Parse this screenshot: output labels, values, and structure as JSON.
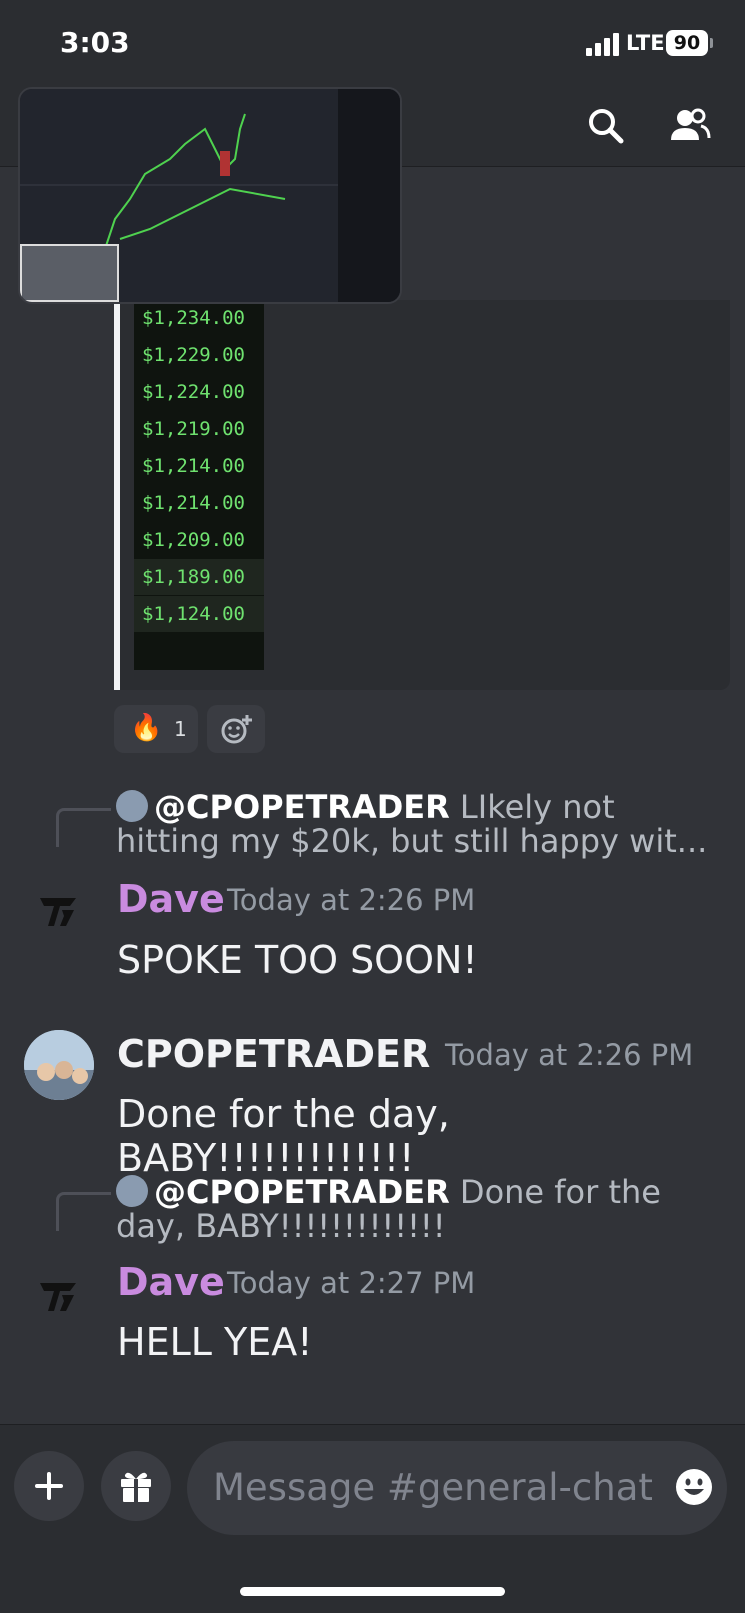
{
  "status_bar": {
    "time": "3:03",
    "network": "LTE",
    "battery": "90"
  },
  "header": {
    "search_icon": "search-icon",
    "members_icon": "members-icon"
  },
  "embed": {
    "prices": [
      "$1,234.00",
      "$1,229.00",
      "$1,224.00",
      "$1,219.00",
      "$1,214.00",
      "$1,214.00",
      "$1,209.00",
      "$1,189.00",
      "$1,124.00"
    ]
  },
  "reactions": [
    {
      "emoji": "🔥",
      "count": "1"
    }
  ],
  "messages": [
    {
      "reply_user": "@CPOPETRADER",
      "reply_text": "LIkely not hitting my $20k, but still happy wit...",
      "username": "Dave",
      "username_color": "#c98bdf",
      "timestamp": "Today at 2:26 PM",
      "content": "SPOKE TOO SOON!"
    },
    {
      "username": "CPOPETRADER",
      "username_color": "#f2f3f5",
      "timestamp": "Today at 2:26 PM",
      "content": "Done for the day, BABY!!!!!!!!!!!!!"
    },
    {
      "reply_user": "@CPOPETRADER",
      "reply_text": "Done for the day, BABY!!!!!!!!!!!!!",
      "username": "Dave",
      "username_color": "#c98bdf",
      "timestamp": "Today at 2:27 PM",
      "content": "HELL YEA!"
    }
  ],
  "composer": {
    "placeholder": "Message #general-chat"
  }
}
